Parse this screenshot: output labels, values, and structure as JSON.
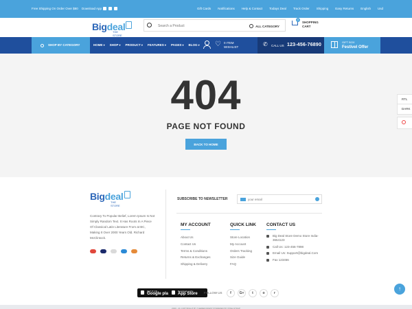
{
  "topbar": {
    "promo": "Free Shipping On Order Over $80",
    "download": "Download App",
    "links": [
      "Gift Cards",
      "Notifications",
      "Help & Contact",
      "Todays Deal",
      "Track Order",
      "Shipping",
      "Easy Returns",
      "English",
      "Usd"
    ]
  },
  "brand": {
    "name_dark": "Big",
    "name_light": "deal",
    "tagline": "THE STORE"
  },
  "search": {
    "placeholder": "Search a Product",
    "category": "ALL CATEGORY"
  },
  "cart": {
    "count": "0",
    "label": "SHOPPING CART"
  },
  "nav": {
    "shop_by_category": "SHOP BY CATEGORY",
    "menu": [
      "HOME",
      "SHOP",
      "PRODUCT",
      "FEATURES",
      "PAGES",
      "BLOG"
    ],
    "wishlist_count": "0 ITEM",
    "wishlist_label": "WISHLIST",
    "call_label": "CALL US",
    "phone": "123-456-76890",
    "gift_small": "GIFT BOX",
    "gift_big": "Festivel Offer"
  },
  "error": {
    "code": "404",
    "message": "PAGE NOT FOUND",
    "back_button": "BACK TO HOME"
  },
  "side_tabs": [
    "RTL",
    "DARK"
  ],
  "footer": {
    "about": "Contrary To Popular Belief, Lorem Ipsum Is Not Simply Random Text. It Has Roots In A Piece Of Classical Latin Literature From at BC, Making It Over 2000 Years Old. Richard McClintock.",
    "newsletter_label": "SUBSCRIBE TO NEWSLETTER",
    "newsletter_placeholder": "your email",
    "account": {
      "title": "MY ACCOUNT",
      "items": [
        "About Us",
        "Contact Us",
        "Terms & Conditions",
        "Returns & Exchanges",
        "Shipping & Delivery"
      ]
    },
    "quick": {
      "title": "QUICK LINK",
      "items": [
        "Store Location",
        "My Account",
        "Orders Tracking",
        "Size Guide",
        "FAQ"
      ]
    },
    "contact": {
      "title": "CONTACT US",
      "address": "Big Deal Store Demo Store India-3654123",
      "phone": "Call Us: 123-456-7898",
      "email": "Email Us: Support@bigdeal.Com",
      "fax": "Fax 123456"
    },
    "google_small": "GET IT ON",
    "google_big": "Google play",
    "apple_small": "Download on the",
    "apple_big": "App Store",
    "follow_label": "FOLLOW US",
    "social": [
      "f",
      "G+",
      "t",
      "o",
      "r"
    ],
    "copyright": "2020 - 21 COPYRIGHT BY THEMEFOREST POWERED BY PIXELSTRAP"
  },
  "colors": {
    "accent": "#4aa3dc",
    "navy": "#1f4f9d",
    "navy_dark": "#173a78",
    "page_bg": "#f4f4f4"
  }
}
